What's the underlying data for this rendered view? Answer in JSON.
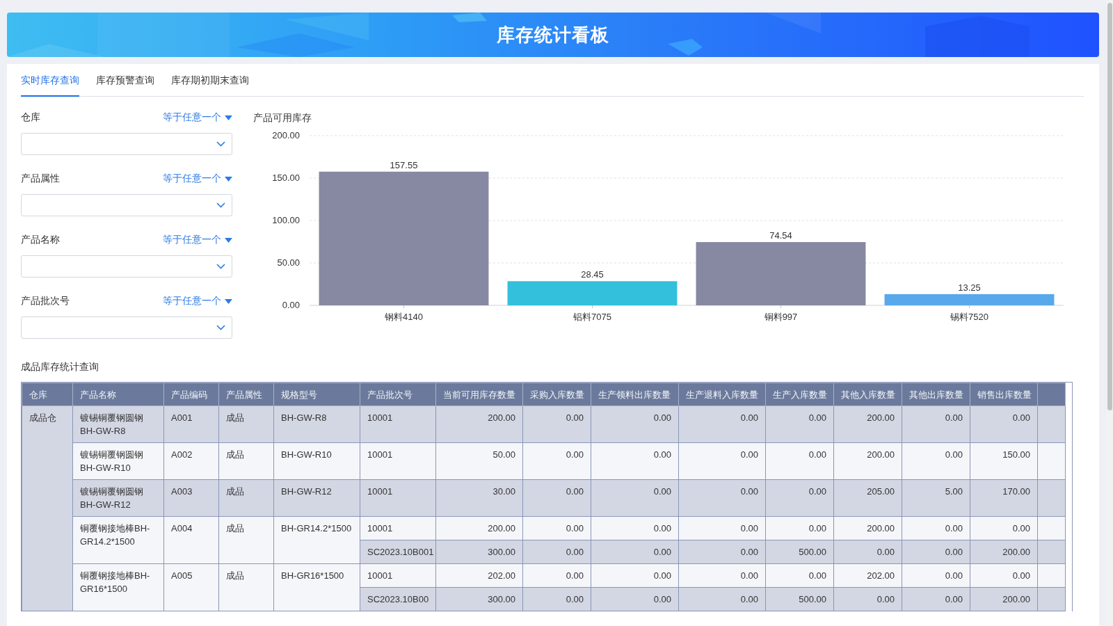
{
  "header": {
    "title": "库存统计看板"
  },
  "tabs": [
    {
      "label": "实时库存查询",
      "selected": true
    },
    {
      "label": "库存预警查询",
      "selected": false
    },
    {
      "label": "库存期初期末查询",
      "selected": false
    }
  ],
  "filters": [
    {
      "label": "仓库",
      "operator": "等于任意一个"
    },
    {
      "label": "产品属性",
      "operator": "等于任意一个"
    },
    {
      "label": "产品名称",
      "operator": "等于任意一个"
    },
    {
      "label": "产品批次号",
      "operator": "等于任意一个"
    }
  ],
  "chart": {
    "title": "产品可用库存",
    "chart_data": {
      "type": "bar",
      "categories": [
        "钢料4140",
        "铝料7075",
        "铜料997",
        "锡料7520"
      ],
      "series": [
        {
          "values": [
            157.55,
            28.45,
            74.54,
            13.25
          ],
          "colors": [
            "#8788a2",
            "#33c0dc",
            "#8788a2",
            "#58a8ec"
          ]
        }
      ],
      "ylim": [
        0,
        200
      ],
      "yticks": [
        {
          "value": 0,
          "label": "0.00"
        },
        {
          "value": 50,
          "label": "50.00"
        },
        {
          "value": 100,
          "label": "100.00"
        },
        {
          "value": 150,
          "label": "150.00"
        },
        {
          "value": 200,
          "label": "200.00"
        }
      ],
      "data_labels": true,
      "grid": true
    }
  },
  "table": {
    "title": "成品库存统计查询",
    "columns": [
      "仓库",
      "产品名称",
      "产品编码",
      "产品属性",
      "规格型号",
      "产品批次号",
      "当前可用库存数量",
      "采购入库数量",
      "生产领料出库数量",
      "生产退料入库数量",
      "生产入库数量",
      "其他入库数量",
      "其他出库数量",
      "销售出库数量"
    ],
    "rows": [
      {
        "warehouse": "成品仓",
        "products": [
          {
            "name": "镀锡铜覆钢圆钢BH-GW-R8",
            "code": "A001",
            "attribute": "成品",
            "spec": "BH-GW-R8",
            "batches": [
              {
                "batch": "10001",
                "values": [
                  "200.00",
                  "0.00",
                  "0.00",
                  "0.00",
                  "0.00",
                  "200.00",
                  "0.00",
                  "0.00"
                ]
              }
            ]
          },
          {
            "name": "镀锡铜覆钢圆钢BH-GW-R10",
            "code": "A002",
            "attribute": "成品",
            "spec": "BH-GW-R10",
            "batches": [
              {
                "batch": "10001",
                "values": [
                  "50.00",
                  "0.00",
                  "0.00",
                  "0.00",
                  "0.00",
                  "200.00",
                  "0.00",
                  "150.00"
                ]
              }
            ]
          },
          {
            "name": "镀锡铜覆钢圆钢BH-GW-R12",
            "code": "A003",
            "attribute": "成品",
            "spec": "BH-GW-R12",
            "batches": [
              {
                "batch": "10001",
                "values": [
                  "30.00",
                  "0.00",
                  "0.00",
                  "0.00",
                  "0.00",
                  "205.00",
                  "5.00",
                  "170.00"
                ]
              }
            ]
          },
          {
            "name": "铜覆钢接地棒BH-GR14.2*1500",
            "code": "A004",
            "attribute": "成品",
            "spec": "BH-GR14.2*1500",
            "batches": [
              {
                "batch": "10001",
                "values": [
                  "200.00",
                  "0.00",
                  "0.00",
                  "0.00",
                  "0.00",
                  "200.00",
                  "0.00",
                  "0.00"
                ]
              },
              {
                "batch": "SC2023.10B001",
                "values": [
                  "300.00",
                  "0.00",
                  "0.00",
                  "0.00",
                  "500.00",
                  "0.00",
                  "0.00",
                  "200.00"
                ]
              }
            ]
          },
          {
            "name": "铜覆钢接地棒BH-GR16*1500",
            "code": "A005",
            "attribute": "成品",
            "spec": "BH-GR16*1500",
            "batches": [
              {
                "batch": "10001",
                "values": [
                  "202.00",
                  "0.00",
                  "0.00",
                  "0.00",
                  "0.00",
                  "202.00",
                  "0.00",
                  "0.00"
                ]
              },
              {
                "batch": "SC2023.10B00",
                "values": [
                  "300.00",
                  "0.00",
                  "0.00",
                  "0.00",
                  "500.00",
                  "0.00",
                  "0.00",
                  "200.00"
                ]
              }
            ]
          }
        ]
      }
    ]
  }
}
